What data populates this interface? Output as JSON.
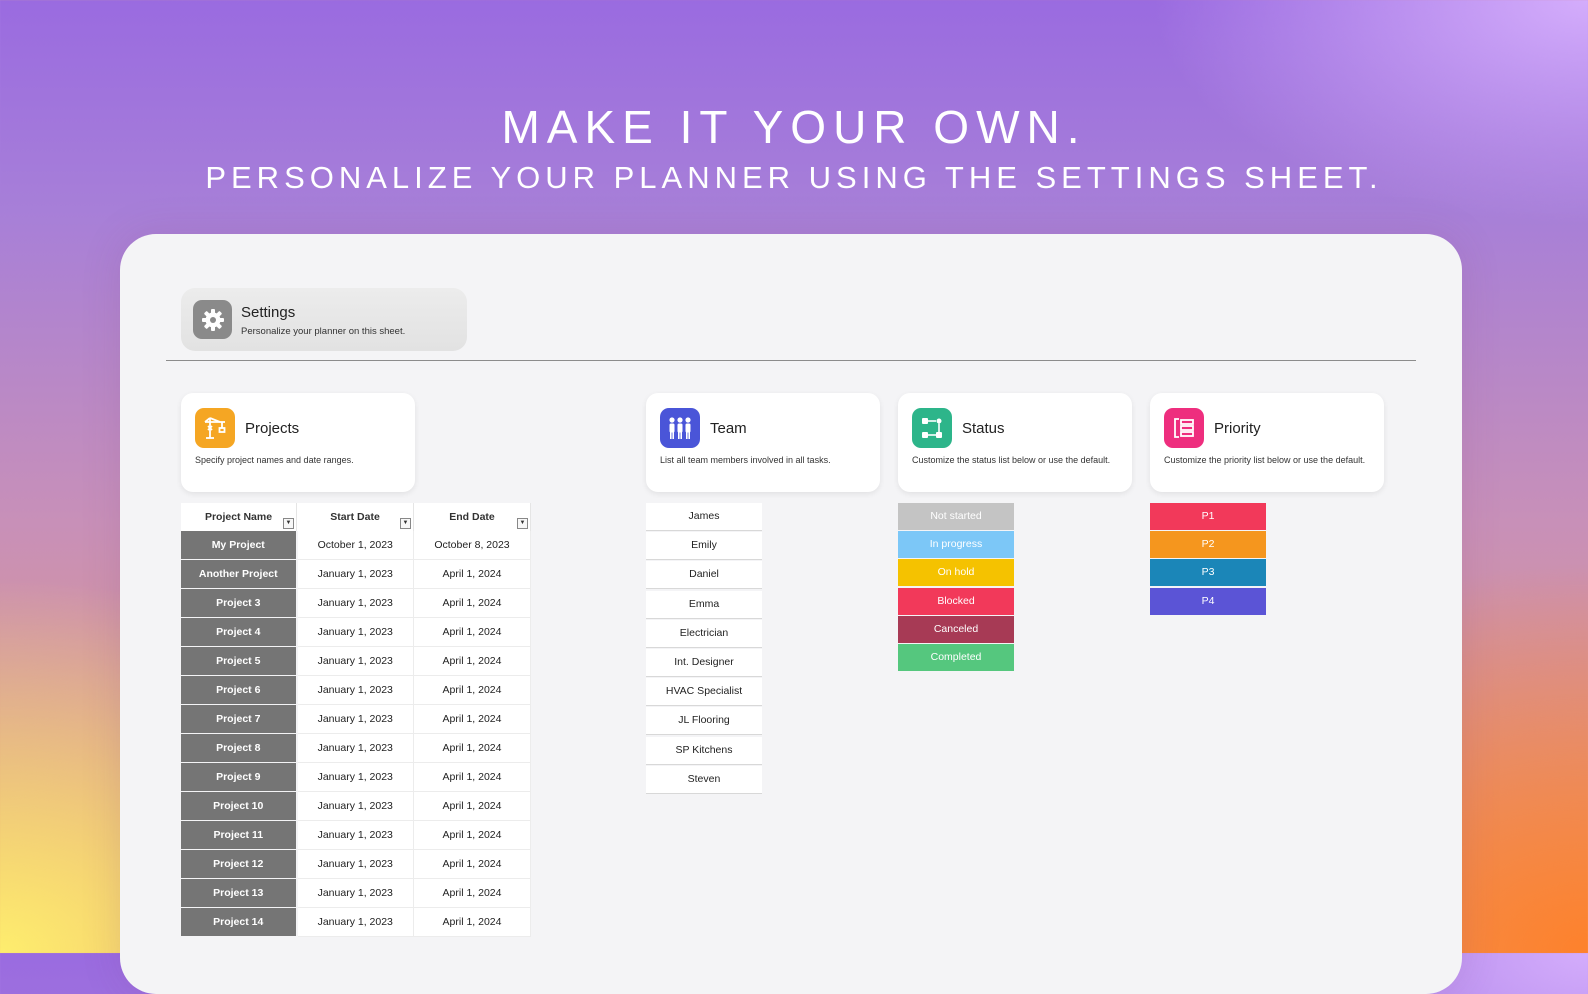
{
  "hero": {
    "title": "MAKE IT YOUR OWN.",
    "subtitle": "PERSONALIZE YOUR PLANNER USING THE SETTINGS SHEET."
  },
  "settings": {
    "title": "Settings",
    "subtitle": "Personalize your planner on this sheet.",
    "icon": "gear-icon"
  },
  "cards": {
    "projects": {
      "title": "Projects",
      "subtitle": "Specify project names and date ranges.",
      "icon": "crane-icon",
      "color": "#F5A623"
    },
    "team": {
      "title": "Team",
      "subtitle": "List all team members involved in all tasks.",
      "icon": "people-icon",
      "color": "#4A55D8"
    },
    "status": {
      "title": "Status",
      "subtitle": "Customize the status list below or use the default.",
      "icon": "flow-icon",
      "color": "#2DB58A"
    },
    "priority": {
      "title": "Priority",
      "subtitle": "Customize the priority list below or use the default.",
      "icon": "list-icon",
      "color": "#EE2E7E"
    }
  },
  "projects_table": {
    "columns": [
      "Project Name",
      "Start Date",
      "End Date"
    ],
    "rows": [
      [
        "My Project",
        "October 1, 2023",
        "October 8, 2023"
      ],
      [
        "Another Project",
        "January 1, 2023",
        "April 1, 2024"
      ],
      [
        "Project 3",
        "January 1, 2023",
        "April 1, 2024"
      ],
      [
        "Project 4",
        "January 1, 2023",
        "April 1, 2024"
      ],
      [
        "Project 5",
        "January 1, 2023",
        "April 1, 2024"
      ],
      [
        "Project 6",
        "January 1, 2023",
        "April 1, 2024"
      ],
      [
        "Project 7",
        "January 1, 2023",
        "April 1, 2024"
      ],
      [
        "Project 8",
        "January 1, 2023",
        "April 1, 2024"
      ],
      [
        "Project 9",
        "January 1, 2023",
        "April 1, 2024"
      ],
      [
        "Project 10",
        "January 1, 2023",
        "April 1, 2024"
      ],
      [
        "Project 11",
        "January 1, 2023",
        "April 1, 2024"
      ],
      [
        "Project 12",
        "January 1, 2023",
        "April 1, 2024"
      ],
      [
        "Project 13",
        "January 1, 2023",
        "April 1, 2024"
      ],
      [
        "Project 14",
        "January 1, 2023",
        "April 1, 2024"
      ]
    ]
  },
  "team": [
    "James",
    "Emily",
    "Daniel",
    "Emma",
    "Electrician",
    "Int. Designer",
    "HVAC Specialist",
    "JL Flooring",
    "SP Kitchens",
    "Steven"
  ],
  "status": [
    {
      "label": "Not started",
      "color": "#C4C4C4"
    },
    {
      "label": "In progress",
      "color": "#7CC7F7"
    },
    {
      "label": "On hold",
      "color": "#F5C200"
    },
    {
      "label": "Blocked",
      "color": "#F2395A"
    },
    {
      "label": "Canceled",
      "color": "#A73A55"
    },
    {
      "label": "Completed",
      "color": "#55C77E"
    }
  ],
  "priority": [
    {
      "label": "P1",
      "color": "#F2395A"
    },
    {
      "label": "P2",
      "color": "#F5961E"
    },
    {
      "label": "P3",
      "color": "#1B86B8"
    },
    {
      "label": "P4",
      "color": "#5B54D6"
    }
  ]
}
